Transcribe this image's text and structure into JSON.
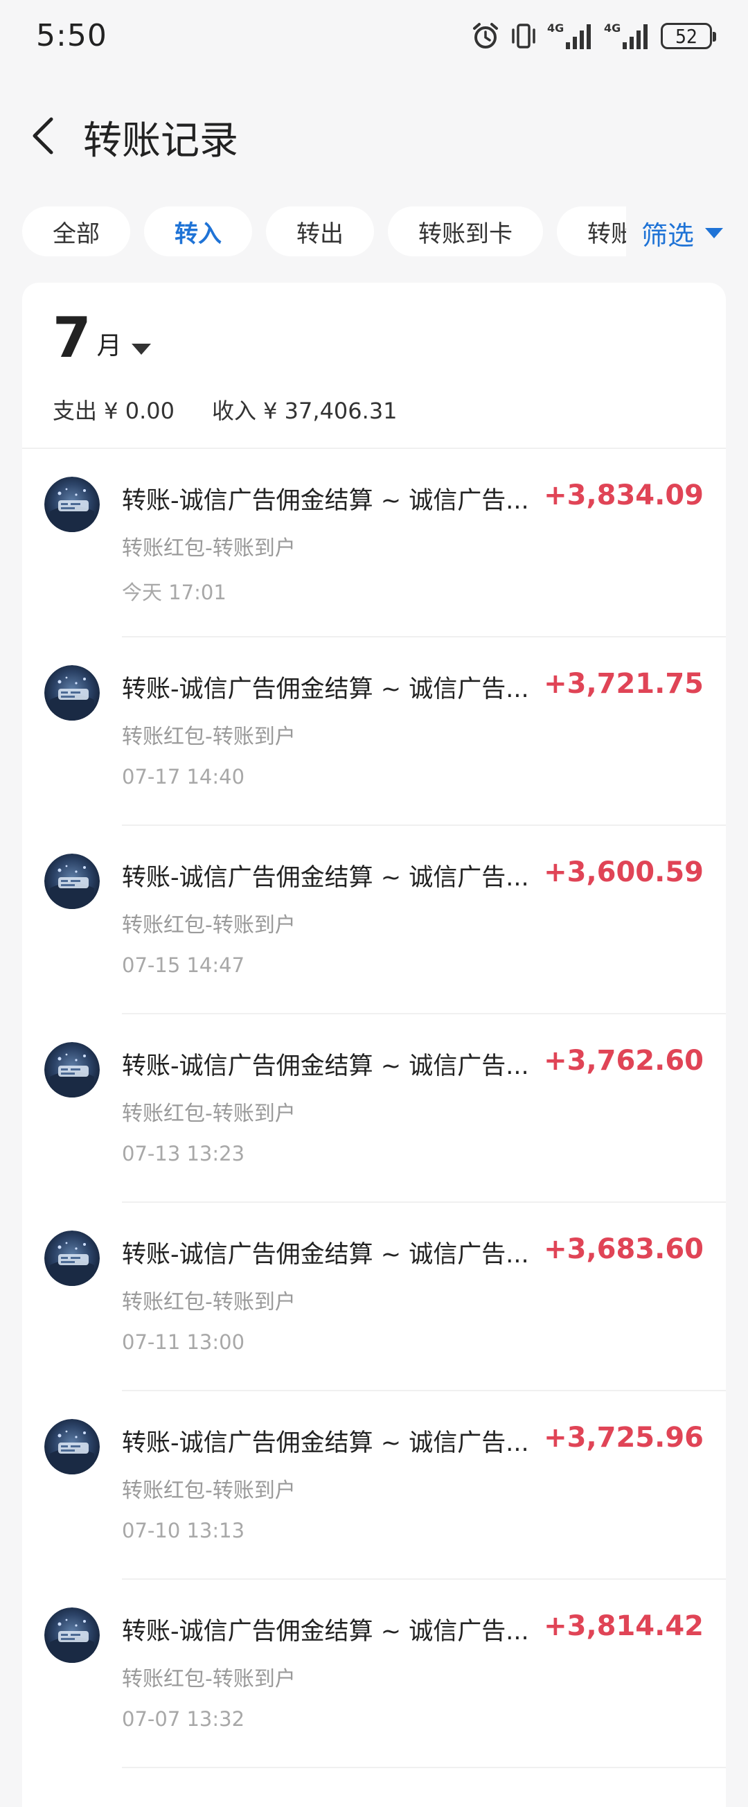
{
  "status_bar": {
    "time": "5:50",
    "battery": "52",
    "network_1": "4G",
    "network_2": "4G"
  },
  "nav": {
    "title": "转账记录"
  },
  "tabs": [
    {
      "label": "全部",
      "active": false
    },
    {
      "label": "转入",
      "active": true
    },
    {
      "label": "转出",
      "active": false
    },
    {
      "label": "转账到卡",
      "active": false
    },
    {
      "label": "转账到银行卡",
      "active": false
    }
  ],
  "filter": {
    "label": "筛选"
  },
  "month": {
    "number": "7",
    "unit": "月",
    "expense": "支出 ¥ 0.00",
    "income": "收入 ¥ 37,406.31"
  },
  "colors": {
    "accent": "#1f73d6",
    "amount": "#e04456",
    "background": "#f6f6f7"
  },
  "transactions": [
    {
      "title": "转账-诚信广告佣金结算 ~ 诚信广告...",
      "subtitle": "转账红包-转账到户",
      "time": "今天 17:01",
      "amount": "+3,834.09"
    },
    {
      "title": "转账-诚信广告佣金结算 ~ 诚信广告...",
      "subtitle": "转账红包-转账到户",
      "time": "07-17 14:40",
      "amount": "+3,721.75"
    },
    {
      "title": "转账-诚信广告佣金结算 ~ 诚信广告...",
      "subtitle": "转账红包-转账到户",
      "time": "07-15 14:47",
      "amount": "+3,600.59"
    },
    {
      "title": "转账-诚信广告佣金结算 ~ 诚信广告...",
      "subtitle": "转账红包-转账到户",
      "time": "07-13 13:23",
      "amount": "+3,762.60"
    },
    {
      "title": "转账-诚信广告佣金结算 ~ 诚信广告...",
      "subtitle": "转账红包-转账到户",
      "time": "07-11 13:00",
      "amount": "+3,683.60"
    },
    {
      "title": "转账-诚信广告佣金结算 ~ 诚信广告...",
      "subtitle": "转账红包-转账到户",
      "time": "07-10 13:13",
      "amount": "+3,725.96"
    },
    {
      "title": "转账-诚信广告佣金结算 ~ 诚信广告...",
      "subtitle": "转账红包-转账到户",
      "time": "07-07 13:32",
      "amount": "+3,814.42"
    }
  ]
}
